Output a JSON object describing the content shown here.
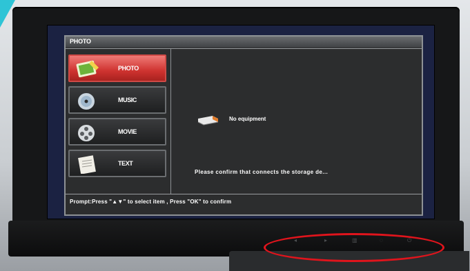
{
  "osd": {
    "title": "PHOTO",
    "menu": [
      {
        "label": "PHOTO",
        "icon": "photo-icon",
        "active": true
      },
      {
        "label": "MUSIC",
        "icon": "music-cd-icon",
        "active": false
      },
      {
        "label": "MOVIE",
        "icon": "film-reel-icon",
        "active": false
      },
      {
        "label": "TEXT",
        "icon": "document-icon",
        "active": false
      }
    ],
    "status": "No equipment",
    "message": "Please confirm that connects the storage de...",
    "prompt": "Prompt:Press \"▲▼\" to select item , Press \"OK\" to confirm"
  },
  "hardware_buttons": [
    {
      "icon": "left-arrow-icon",
      "glyph": "◂"
    },
    {
      "icon": "right-arrow-icon",
      "glyph": "▸"
    },
    {
      "icon": "menu-icon",
      "glyph": "▥"
    },
    {
      "icon": "source-icon",
      "glyph": "◌"
    },
    {
      "icon": "power-icon",
      "glyph": "⏻"
    }
  ],
  "colors": {
    "active_item": "#cf3330",
    "osd_background": "#2c2d2e",
    "annotation_ellipse": "#e0141c"
  }
}
